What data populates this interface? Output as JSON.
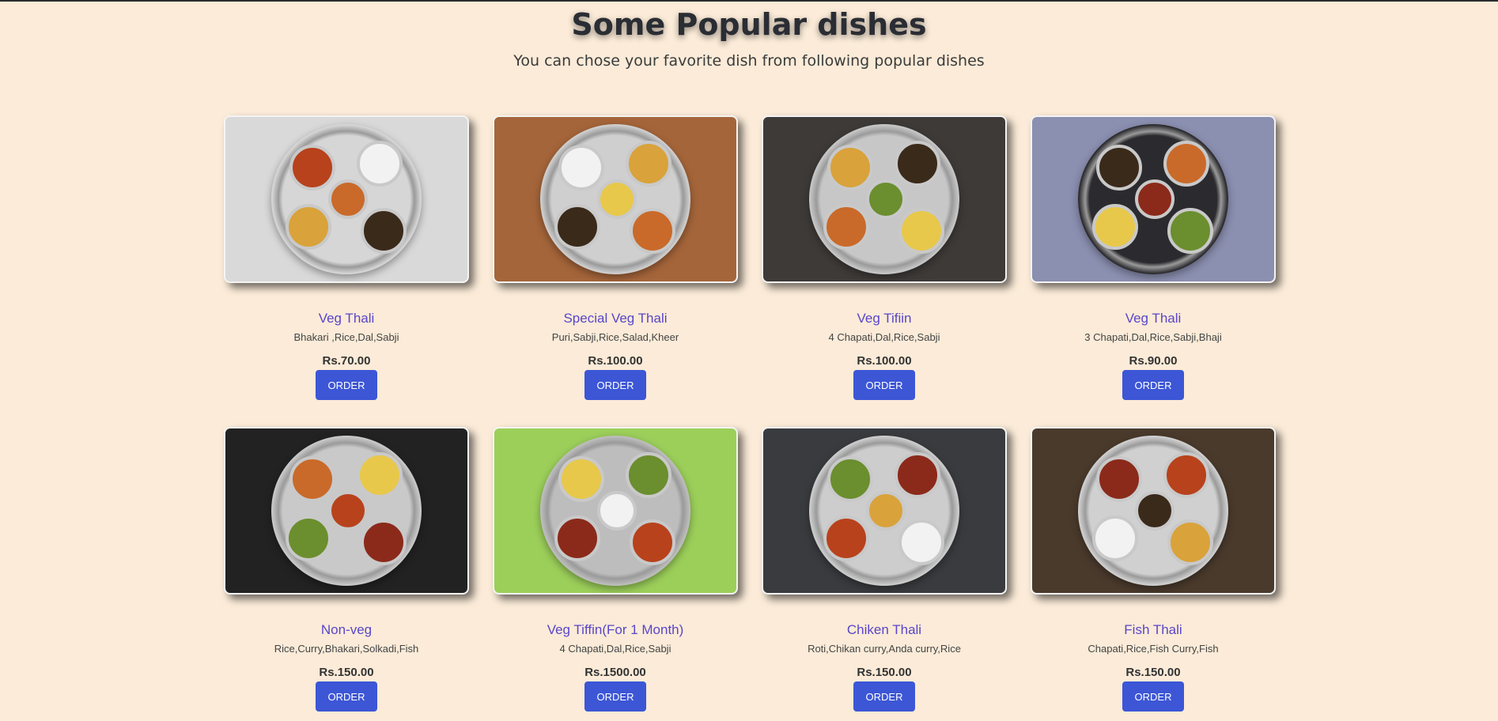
{
  "header": {
    "title": "Some Popular dishes",
    "subtitle": "You can chose your favorite dish from following popular dishes"
  },
  "dishes": [
    {
      "name": "Veg Thali",
      "desc": "Bhakari ,Rice,Dal,Sabji",
      "price": "Rs.70.00",
      "button": "ORDER",
      "bg": "#d9d9d9",
      "plate": "#d6d6d6"
    },
    {
      "name": "Special Veg Thali",
      "desc": "Puri,Sabji,Rice,Salad,Kheer",
      "price": "Rs.100.00",
      "button": "ORDER",
      "bg": "#a5653a",
      "plate": "#cfcfcf"
    },
    {
      "name": "Veg Tifiin",
      "desc": "4 Chapati,Dal,Rice,Sabji",
      "price": "Rs.100.00",
      "button": "ORDER",
      "bg": "#3e3a38",
      "plate": "#c7c7c7"
    },
    {
      "name": "Veg Thali",
      "desc": "3 Chapati,Dal,Rice,Sabji,Bhaji",
      "price": "Rs.90.00",
      "button": "ORDER",
      "bg": "#8b8fb0",
      "plate": "#2b2b2f"
    },
    {
      "name": "Non-veg",
      "desc": "Rice,Curry,Bhakari,Solkadi,Fish",
      "price": "Rs.150.00",
      "button": "ORDER",
      "bg": "#222222",
      "plate": "#c9c9c9"
    },
    {
      "name": "Veg Tiffin(For 1 Month)",
      "desc": "4 Chapati,Dal,Rice,Sabji",
      "price": "Rs.1500.00",
      "button": "ORDER",
      "bg": "#9ccf5a",
      "plate": "#bdbdbd"
    },
    {
      "name": "Chiken Thali",
      "desc": "Roti,Chikan curry,Anda curry,Rice",
      "price": "Rs.150.00",
      "button": "ORDER",
      "bg": "#3a3b3f",
      "plate": "#cdcdcd"
    },
    {
      "name": "Fish Thali",
      "desc": "Chapati,Rice,Fish Curry,Fish",
      "price": "Rs.150.00",
      "button": "ORDER",
      "bg": "#4a3a2c",
      "plate": "#d0d0d0"
    }
  ]
}
